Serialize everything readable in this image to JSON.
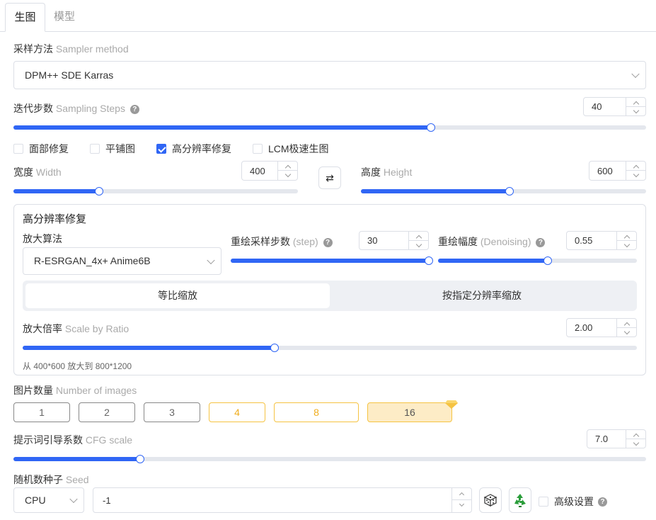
{
  "tabs": [
    {
      "label": "生图"
    },
    {
      "label": "模型"
    }
  ],
  "sampler": {
    "label": "采样方法",
    "label_en": "Sampler method",
    "value": "DPM++ SDE Karras"
  },
  "steps": {
    "label": "迭代步数",
    "label_en": "Sampling Steps",
    "value": "40",
    "fill": 0.66
  },
  "options": [
    {
      "label": "面部修复",
      "checked": false
    },
    {
      "label": "平铺图",
      "checked": false
    },
    {
      "label": "高分辨率修复",
      "checked": true
    },
    {
      "label": "LCM极速生图",
      "checked": false
    }
  ],
  "width": {
    "label": "宽度",
    "label_en": "Width",
    "value": "400",
    "fill": 0.3
  },
  "height": {
    "label": "高度",
    "label_en": "Height",
    "value": "600",
    "fill": 0.52
  },
  "swap_icon": "⇄",
  "hires": {
    "title": "高分辨率修复",
    "upscaler": {
      "label": "放大算法",
      "value": "R-ESRGAN_4x+ Anime6B"
    },
    "hires_steps": {
      "label": "重绘采样步数",
      "label_en": "(step)",
      "value": "30",
      "fill": 1.0
    },
    "denoising": {
      "label": "重绘幅度",
      "label_en": "(Denoising)",
      "value": "0.55",
      "fill": 0.55
    },
    "modes": [
      {
        "label": "等比缩放"
      },
      {
        "label": "按指定分辨率缩放"
      }
    ],
    "scale": {
      "label": "放大倍率",
      "label_en": "Scale by Ratio",
      "value": "2.00",
      "fill": 0.41
    },
    "note": "从 400*600 放大到 800*1200"
  },
  "num_images": {
    "label": "图片数量",
    "label_en": "Number of images",
    "options": [
      "1",
      "2",
      "3",
      "4",
      "8",
      "16"
    ],
    "selected": "16"
  },
  "cfg": {
    "label": "提示词引导系数",
    "label_en": "CFG scale",
    "value": "7.0",
    "fill": 0.2
  },
  "seed": {
    "label": "随机数种子",
    "label_en": "Seed",
    "device": "CPU",
    "value": "-1"
  },
  "advanced": {
    "label": "高级设置"
  }
}
